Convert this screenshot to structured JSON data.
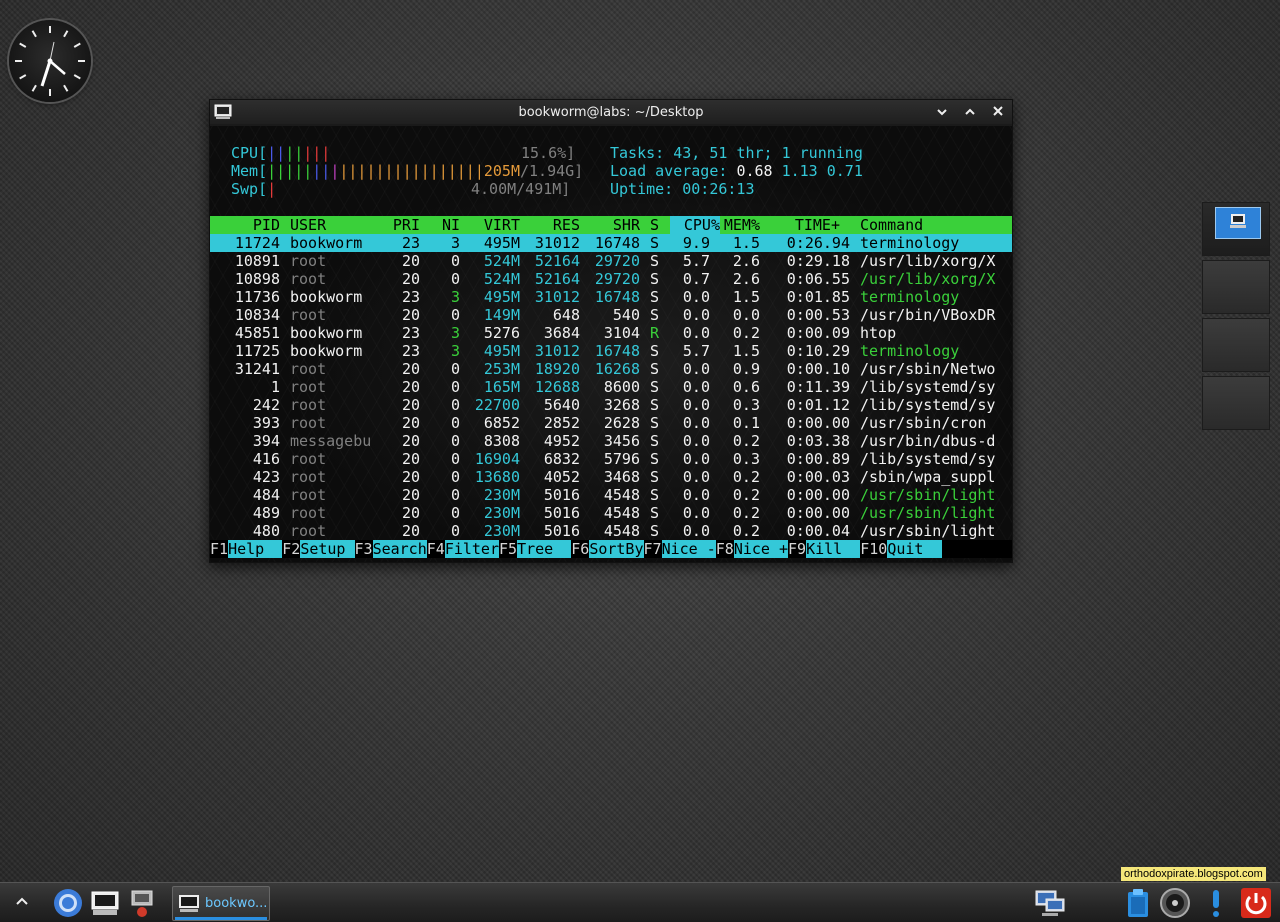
{
  "window": {
    "title": "bookworm@labs: ~/Desktop"
  },
  "meters": {
    "cpu_label": "CPU[",
    "cpu_bars": "|||||||",
    "cpu_value": "15.6%]",
    "mem_label": "Mem[",
    "mem_bars": "|||||||||||||||||||||||",
    "mem_value_used": "205M",
    "mem_value_total": "/1.94G]",
    "swp_label": "Swp[",
    "swp_bars": "|",
    "swp_value": "4.00M/491M]",
    "tasks_label": "Tasks:",
    "tasks_count": "43,",
    "threads_count": "51",
    "threads_label": "thr;",
    "running_count": "1",
    "running_label": "running",
    "load_label": "Load average:",
    "load_1": "0.68",
    "load_5": "1.13",
    "load_15": "0.71",
    "uptime_label": "Uptime:",
    "uptime_value": "00:26:13"
  },
  "columns": {
    "pid": "PID",
    "user": "USER",
    "pri": "PRI",
    "ni": "NI",
    "virt": "VIRT",
    "res": "RES",
    "shr": "SHR",
    "s": "S",
    "cpu": "CPU%",
    "mem": "MEM%",
    "time": "TIME+",
    "command": "Command"
  },
  "processes": [
    {
      "pid": "11724",
      "user": "bookworm",
      "pri": "23",
      "ni": "3",
      "virt": "495M",
      "res": "31012",
      "shr": "16748",
      "s": "S",
      "cpu": "9.9",
      "mem": "1.5",
      "time": "0:26.94",
      "command": "terminology"
    },
    {
      "pid": "10891",
      "user": "root",
      "pri": "20",
      "ni": "0",
      "virt": "524M",
      "res": "52164",
      "shr": "29720",
      "s": "S",
      "cpu": "5.7",
      "mem": "2.6",
      "time": "0:29.18",
      "command": "/usr/lib/xorg/X"
    },
    {
      "pid": "10898",
      "user": "root",
      "pri": "20",
      "ni": "0",
      "virt": "524M",
      "res": "52164",
      "shr": "29720",
      "s": "S",
      "cpu": "0.7",
      "mem": "2.6",
      "time": "0:06.55",
      "command": "/usr/lib/xorg/X"
    },
    {
      "pid": "11736",
      "user": "bookworm",
      "pri": "23",
      "ni": "3",
      "virt": "495M",
      "res": "31012",
      "shr": "16748",
      "s": "S",
      "cpu": "0.0",
      "mem": "1.5",
      "time": "0:01.85",
      "command": "terminology"
    },
    {
      "pid": "10834",
      "user": "root",
      "pri": "20",
      "ni": "0",
      "virt": "149M",
      "res": "648",
      "shr": "540",
      "s": "S",
      "cpu": "0.0",
      "mem": "0.0",
      "time": "0:00.53",
      "command": "/usr/bin/VBoxDR"
    },
    {
      "pid": "45851",
      "user": "bookworm",
      "pri": "23",
      "ni": "3",
      "virt": "5276",
      "res": "3684",
      "shr": "3104",
      "s": "R",
      "cpu": "0.0",
      "mem": "0.2",
      "time": "0:00.09",
      "command": "htop"
    },
    {
      "pid": "11725",
      "user": "bookworm",
      "pri": "23",
      "ni": "3",
      "virt": "495M",
      "res": "31012",
      "shr": "16748",
      "s": "S",
      "cpu": "5.7",
      "mem": "1.5",
      "time": "0:10.29",
      "command": "terminology"
    },
    {
      "pid": "31241",
      "user": "root",
      "pri": "20",
      "ni": "0",
      "virt": "253M",
      "res": "18920",
      "shr": "16268",
      "s": "S",
      "cpu": "0.0",
      "mem": "0.9",
      "time": "0:00.10",
      "command": "/usr/sbin/Netwo"
    },
    {
      "pid": "1",
      "user": "root",
      "pri": "20",
      "ni": "0",
      "virt": "165M",
      "res": "12688",
      "shr": "8600",
      "s": "S",
      "cpu": "0.0",
      "mem": "0.6",
      "time": "0:11.39",
      "command": "/lib/systemd/sy"
    },
    {
      "pid": "242",
      "user": "root",
      "pri": "20",
      "ni": "0",
      "virt": "22700",
      "res": "5640",
      "shr": "3268",
      "s": "S",
      "cpu": "0.0",
      "mem": "0.3",
      "time": "0:01.12",
      "command": "/lib/systemd/sy"
    },
    {
      "pid": "393",
      "user": "root",
      "pri": "20",
      "ni": "0",
      "virt": "6852",
      "res": "2852",
      "shr": "2628",
      "s": "S",
      "cpu": "0.0",
      "mem": "0.1",
      "time": "0:00.00",
      "command": "/usr/sbin/cron"
    },
    {
      "pid": "394",
      "user": "messagebu",
      "pri": "20",
      "ni": "0",
      "virt": "8308",
      "res": "4952",
      "shr": "3456",
      "s": "S",
      "cpu": "0.0",
      "mem": "0.2",
      "time": "0:03.38",
      "command": "/usr/bin/dbus-d"
    },
    {
      "pid": "416",
      "user": "root",
      "pri": "20",
      "ni": "0",
      "virt": "16904",
      "res": "6832",
      "shr": "5796",
      "s": "S",
      "cpu": "0.0",
      "mem": "0.3",
      "time": "0:00.89",
      "command": "/lib/systemd/sy"
    },
    {
      "pid": "423",
      "user": "root",
      "pri": "20",
      "ni": "0",
      "virt": "13680",
      "res": "4052",
      "shr": "3468",
      "s": "S",
      "cpu": "0.0",
      "mem": "0.2",
      "time": "0:00.03",
      "command": "/sbin/wpa_suppl"
    },
    {
      "pid": "484",
      "user": "root",
      "pri": "20",
      "ni": "0",
      "virt": "230M",
      "res": "5016",
      "shr": "4548",
      "s": "S",
      "cpu": "0.0",
      "mem": "0.2",
      "time": "0:00.00",
      "command": "/usr/sbin/light"
    },
    {
      "pid": "489",
      "user": "root",
      "pri": "20",
      "ni": "0",
      "virt": "230M",
      "res": "5016",
      "shr": "4548",
      "s": "S",
      "cpu": "0.0",
      "mem": "0.2",
      "time": "0:00.00",
      "command": "/usr/sbin/light"
    },
    {
      "pid": "480",
      "user": "root",
      "pri": "20",
      "ni": "0",
      "virt": "230M",
      "res": "5016",
      "shr": "4548",
      "s": "S",
      "cpu": "0.0",
      "mem": "0.2",
      "time": "0:00.04",
      "command": "/usr/sbin/light"
    }
  ],
  "fkeys": [
    {
      "num": "F1",
      "label": "Help  "
    },
    {
      "num": "F2",
      "label": "Setup "
    },
    {
      "num": "F3",
      "label": "Search"
    },
    {
      "num": "F4",
      "label": "Filter"
    },
    {
      "num": "F5",
      "label": "Tree  "
    },
    {
      "num": "F6",
      "label": "SortBy"
    },
    {
      "num": "F7",
      "label": "Nice -"
    },
    {
      "num": "F8",
      "label": "Nice +"
    },
    {
      "num": "F9",
      "label": "Kill  "
    },
    {
      "num": "F10",
      "label": "Quit  "
    }
  ],
  "taskbar": {
    "task_label": "bookwo..."
  },
  "watermark": "orthodoxpirate.blogspot.com",
  "icons": {
    "clock": "analog-clock-icon",
    "terminal": "terminal-icon",
    "browser": "chromium-icon",
    "network": "network-icon",
    "clipboard": "clipboard-icon",
    "mixer": "mixer-icon",
    "alert": "alert-icon",
    "power": "power-icon"
  },
  "colors": {
    "header_bg": "#3ad03a",
    "selected_bg": "#34c8d8",
    "accent_blue": "#2a8ee0"
  }
}
